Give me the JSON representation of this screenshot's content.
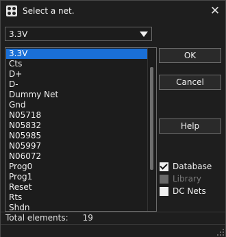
{
  "window": {
    "title": "Select a net."
  },
  "combo": {
    "value": "3.3V"
  },
  "list": {
    "items": [
      "3.3V",
      "Cts",
      "D+",
      "D-",
      "Dummy Net",
      "Gnd",
      "N05718",
      "N05832",
      "N05985",
      "N05997",
      "N06072",
      "Prog0",
      "Prog1",
      "Reset",
      "Rts",
      "Shdn"
    ],
    "selected_index": 0
  },
  "buttons": {
    "ok": "OK",
    "cancel": "Cancel",
    "help": "Help"
  },
  "checkboxes": {
    "database": {
      "label": "Database",
      "checked": true,
      "enabled": true
    },
    "library": {
      "label": "Library",
      "checked": false,
      "enabled": false
    },
    "dc_nets": {
      "label": "DC Nets",
      "checked": false,
      "enabled": true
    }
  },
  "status": {
    "label": "Total elements:",
    "count": "19"
  },
  "icons": {
    "close": "close-icon",
    "dropdown": "chevron-down-icon",
    "app": "app-icon"
  }
}
